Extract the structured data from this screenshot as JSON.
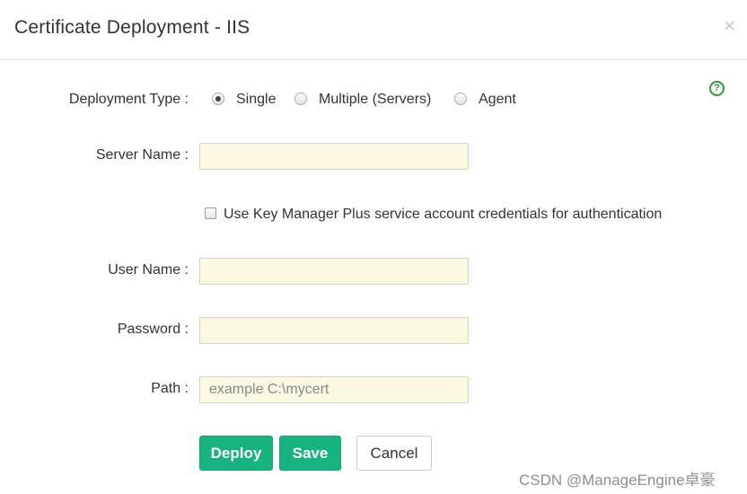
{
  "dialog": {
    "title": "Certificate Deployment - IIS",
    "close_symbol": "×",
    "help_symbol": "?"
  },
  "form": {
    "deployment_type": {
      "label": "Deployment Type :",
      "options": [
        "Single",
        "Multiple (Servers)",
        "Agent"
      ],
      "selected": "Single"
    },
    "server_name": {
      "label": "Server Name :",
      "value": "",
      "placeholder": ""
    },
    "use_service_account": {
      "label": "Use Key Manager Plus service account credentials for authentication",
      "checked": false
    },
    "user_name": {
      "label": "User Name :",
      "value": "",
      "placeholder": ""
    },
    "password": {
      "label": "Password :",
      "value": "",
      "placeholder": ""
    },
    "path": {
      "label": "Path :",
      "value": "",
      "placeholder": "example C:\\mycert"
    }
  },
  "buttons": {
    "deploy": "Deploy",
    "save": "Save",
    "cancel": "Cancel"
  },
  "colors": {
    "primary": "#17b37d",
    "input_bg": "#fcf7e1",
    "help_icon": "#2a9a3c"
  },
  "watermark": "CSDN @ManageEngine卓豪"
}
